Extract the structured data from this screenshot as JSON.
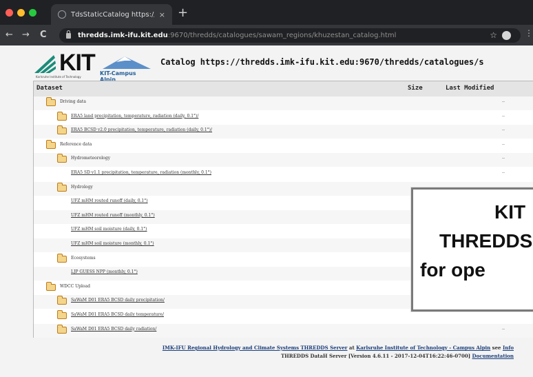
{
  "browser": {
    "tab_title": "TdsStaticCatalog https://thredd",
    "tab_close": "×",
    "new_tab": "+",
    "nav": {
      "back": "←",
      "forward": "→",
      "reload": "C"
    },
    "url_host": "thredds.imk-ifu.kit.edu",
    "url_path": ":9670/thredds/catalogues/sawam_regions/khuzestan_catalog.html",
    "star_icon": "☆",
    "more_icon": "⋮"
  },
  "logos": {
    "kit_text": "KIT",
    "kit_subtitle": "Karlsruhe Institute of Technology",
    "alpin_text": "KIT-Campus Alpin"
  },
  "catalog_title": "Catalog https://thredds.imk-ifu.kit.edu:9670/thredds/catalogues/s",
  "table": {
    "headers": {
      "dataset": "Dataset",
      "size": "Size",
      "last_modified": "Last Modified"
    },
    "rows": [
      {
        "label": "Driving data",
        "folder": true,
        "link": false,
        "lastmod": "--"
      },
      {
        "label": "ERA5 land precipitation, temperature, radiation (daily, 0.1°)/",
        "folder": true,
        "link": true,
        "lastmod": "--"
      },
      {
        "label": "ERA5 BCSD v2.0 precipitation, temperature, radiation (daily, 0.1°)/",
        "folder": true,
        "link": true,
        "lastmod": "--"
      },
      {
        "label": "Reference data",
        "folder": true,
        "link": false,
        "lastmod": "--"
      },
      {
        "label": "Hydrometeorology",
        "folder": true,
        "link": false,
        "lastmod": "--"
      },
      {
        "label": "ERA5 SD v1.1 precipitation, temperature, radiation (monthly, 0.1°)",
        "folder": false,
        "link": true,
        "lastmod": "--"
      },
      {
        "label": "Hydrology",
        "folder": true,
        "link": false,
        "lastmod": ""
      },
      {
        "label": "UFZ mHM routed runoff (daily, 0.1°)",
        "folder": false,
        "link": true,
        "lastmod": ""
      },
      {
        "label": "UFZ mHM routed runoff (monthly, 0.1°)",
        "folder": false,
        "link": true,
        "lastmod": ""
      },
      {
        "label": "UFZ mHM soil moisture (daily, 0.1°)",
        "folder": false,
        "link": true,
        "lastmod": ""
      },
      {
        "label": "UFZ mHM soil moisture (monthly, 0.1°)",
        "folder": false,
        "link": true,
        "lastmod": ""
      },
      {
        "label": "Ecosystems",
        "folder": true,
        "link": false,
        "lastmod": ""
      },
      {
        "label": "LJP GUESS NPP (monthly, 0.1°)",
        "folder": false,
        "link": true,
        "lastmod": ""
      },
      {
        "label": "WDCC Upload",
        "folder": true,
        "link": false,
        "lastmod": ""
      },
      {
        "label": "SaWaM D01 ERA5 BCSD daily precipitation/",
        "folder": true,
        "link": true,
        "lastmod": ""
      },
      {
        "label": "SaWaM D01 ERA5 BCSD daily temperature/",
        "folder": true,
        "link": true,
        "lastmod": ""
      },
      {
        "label": "SaWaM D01 ERA5 BCSD daily radiation/",
        "folder": true,
        "link": true,
        "lastmod": "--"
      }
    ]
  },
  "footer": {
    "line1_a": "IMK-IFU Regional Hydrology and Climate Systems THREDDS Server",
    "line1_b": " at ",
    "line1_c": "Karlsruhe Institute of Technology - Campus Alpin",
    "line1_d": " see ",
    "line1_e": "Info",
    "line2_a": "THREDDS DataH Server [Version 4.6.11 - 2017-12-04T16:22:46-0700] ",
    "line2_b": "Documentation"
  },
  "overlay": {
    "line1": "KIT",
    "line2": "THREDDS",
    "line3": "for ope"
  },
  "colors": {
    "traffic_red": "#ff5f56",
    "traffic_yellow": "#ffbd2e",
    "traffic_green": "#27c93f",
    "folder_fill": "#f3d58c",
    "folder_stroke": "#c07a13",
    "alpin_blue": "#1f5c99"
  }
}
